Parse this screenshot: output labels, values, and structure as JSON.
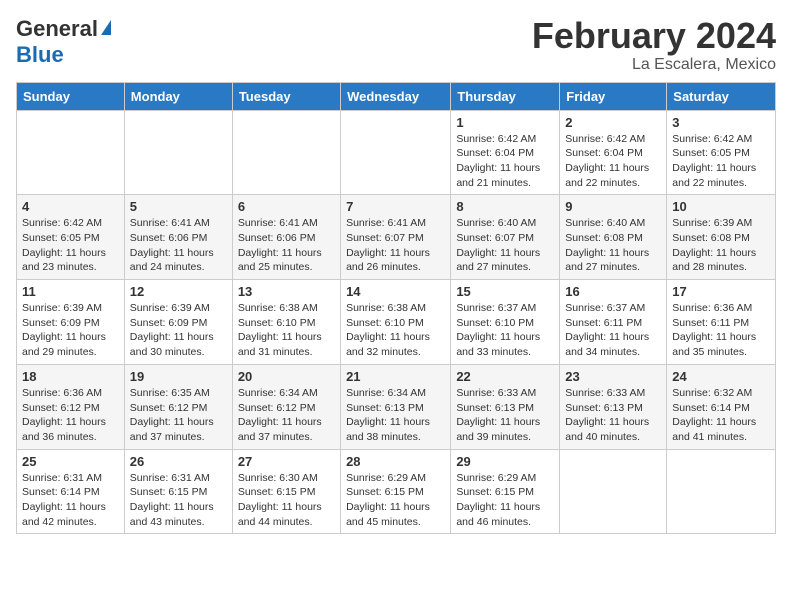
{
  "header": {
    "logo_general": "General",
    "logo_blue": "Blue",
    "month_title": "February 2024",
    "subtitle": "La Escalera, Mexico"
  },
  "columns": [
    "Sunday",
    "Monday",
    "Tuesday",
    "Wednesday",
    "Thursday",
    "Friday",
    "Saturday"
  ],
  "weeks": [
    [
      {
        "day": "",
        "info": ""
      },
      {
        "day": "",
        "info": ""
      },
      {
        "day": "",
        "info": ""
      },
      {
        "day": "",
        "info": ""
      },
      {
        "day": "1",
        "info": "Sunrise: 6:42 AM\nSunset: 6:04 PM\nDaylight: 11 hours and 21 minutes."
      },
      {
        "day": "2",
        "info": "Sunrise: 6:42 AM\nSunset: 6:04 PM\nDaylight: 11 hours and 22 minutes."
      },
      {
        "day": "3",
        "info": "Sunrise: 6:42 AM\nSunset: 6:05 PM\nDaylight: 11 hours and 22 minutes."
      }
    ],
    [
      {
        "day": "4",
        "info": "Sunrise: 6:42 AM\nSunset: 6:05 PM\nDaylight: 11 hours and 23 minutes."
      },
      {
        "day": "5",
        "info": "Sunrise: 6:41 AM\nSunset: 6:06 PM\nDaylight: 11 hours and 24 minutes."
      },
      {
        "day": "6",
        "info": "Sunrise: 6:41 AM\nSunset: 6:06 PM\nDaylight: 11 hours and 25 minutes."
      },
      {
        "day": "7",
        "info": "Sunrise: 6:41 AM\nSunset: 6:07 PM\nDaylight: 11 hours and 26 minutes."
      },
      {
        "day": "8",
        "info": "Sunrise: 6:40 AM\nSunset: 6:07 PM\nDaylight: 11 hours and 27 minutes."
      },
      {
        "day": "9",
        "info": "Sunrise: 6:40 AM\nSunset: 6:08 PM\nDaylight: 11 hours and 27 minutes."
      },
      {
        "day": "10",
        "info": "Sunrise: 6:39 AM\nSunset: 6:08 PM\nDaylight: 11 hours and 28 minutes."
      }
    ],
    [
      {
        "day": "11",
        "info": "Sunrise: 6:39 AM\nSunset: 6:09 PM\nDaylight: 11 hours and 29 minutes."
      },
      {
        "day": "12",
        "info": "Sunrise: 6:39 AM\nSunset: 6:09 PM\nDaylight: 11 hours and 30 minutes."
      },
      {
        "day": "13",
        "info": "Sunrise: 6:38 AM\nSunset: 6:10 PM\nDaylight: 11 hours and 31 minutes."
      },
      {
        "day": "14",
        "info": "Sunrise: 6:38 AM\nSunset: 6:10 PM\nDaylight: 11 hours and 32 minutes."
      },
      {
        "day": "15",
        "info": "Sunrise: 6:37 AM\nSunset: 6:10 PM\nDaylight: 11 hours and 33 minutes."
      },
      {
        "day": "16",
        "info": "Sunrise: 6:37 AM\nSunset: 6:11 PM\nDaylight: 11 hours and 34 minutes."
      },
      {
        "day": "17",
        "info": "Sunrise: 6:36 AM\nSunset: 6:11 PM\nDaylight: 11 hours and 35 minutes."
      }
    ],
    [
      {
        "day": "18",
        "info": "Sunrise: 6:36 AM\nSunset: 6:12 PM\nDaylight: 11 hours and 36 minutes."
      },
      {
        "day": "19",
        "info": "Sunrise: 6:35 AM\nSunset: 6:12 PM\nDaylight: 11 hours and 37 minutes."
      },
      {
        "day": "20",
        "info": "Sunrise: 6:34 AM\nSunset: 6:12 PM\nDaylight: 11 hours and 37 minutes."
      },
      {
        "day": "21",
        "info": "Sunrise: 6:34 AM\nSunset: 6:13 PM\nDaylight: 11 hours and 38 minutes."
      },
      {
        "day": "22",
        "info": "Sunrise: 6:33 AM\nSunset: 6:13 PM\nDaylight: 11 hours and 39 minutes."
      },
      {
        "day": "23",
        "info": "Sunrise: 6:33 AM\nSunset: 6:13 PM\nDaylight: 11 hours and 40 minutes."
      },
      {
        "day": "24",
        "info": "Sunrise: 6:32 AM\nSunset: 6:14 PM\nDaylight: 11 hours and 41 minutes."
      }
    ],
    [
      {
        "day": "25",
        "info": "Sunrise: 6:31 AM\nSunset: 6:14 PM\nDaylight: 11 hours and 42 minutes."
      },
      {
        "day": "26",
        "info": "Sunrise: 6:31 AM\nSunset: 6:15 PM\nDaylight: 11 hours and 43 minutes."
      },
      {
        "day": "27",
        "info": "Sunrise: 6:30 AM\nSunset: 6:15 PM\nDaylight: 11 hours and 44 minutes."
      },
      {
        "day": "28",
        "info": "Sunrise: 6:29 AM\nSunset: 6:15 PM\nDaylight: 11 hours and 45 minutes."
      },
      {
        "day": "29",
        "info": "Sunrise: 6:29 AM\nSunset: 6:15 PM\nDaylight: 11 hours and 46 minutes."
      },
      {
        "day": "",
        "info": ""
      },
      {
        "day": "",
        "info": ""
      }
    ]
  ]
}
